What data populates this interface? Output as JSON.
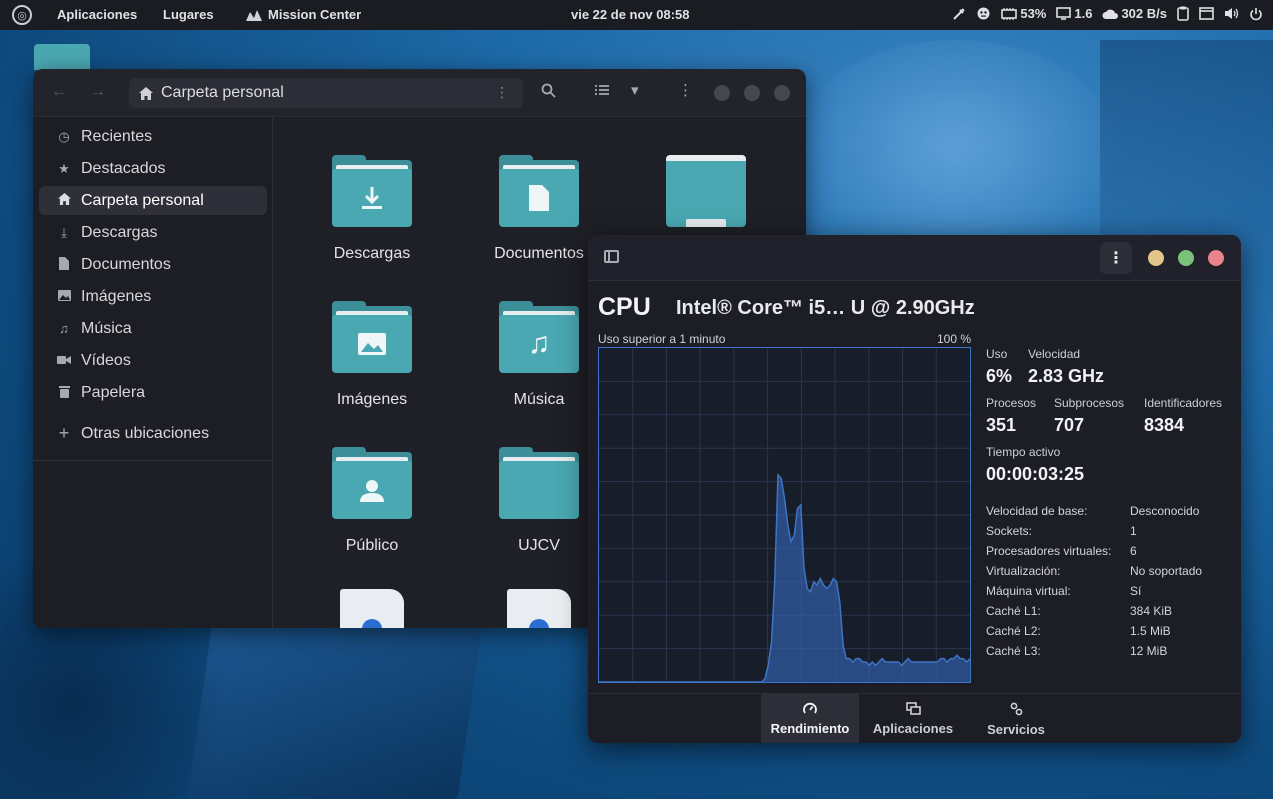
{
  "topbar": {
    "applications": "Aplicaciones",
    "places": "Lugares",
    "active_app": "Mission Center",
    "clock": "vie 22 de nov  08:58",
    "battery": "53%",
    "load": "1.6",
    "network": "302 B/s"
  },
  "file_manager": {
    "path": "Carpeta personal",
    "sidebar": [
      {
        "label": "Recientes",
        "icon": "clock-icon"
      },
      {
        "label": "Destacados",
        "icon": "star-icon"
      },
      {
        "label": "Carpeta personal",
        "icon": "home-icon",
        "active": true
      },
      {
        "label": "Descargas",
        "icon": "download-icon"
      },
      {
        "label": "Documentos",
        "icon": "document-icon"
      },
      {
        "label": "Imágenes",
        "icon": "image-icon"
      },
      {
        "label": "Música",
        "icon": "music-icon"
      },
      {
        "label": "Vídeos",
        "icon": "video-icon"
      },
      {
        "label": "Papelera",
        "icon": "trash-icon"
      }
    ],
    "other_locations": "Otras ubicaciones",
    "folders": [
      {
        "label": "Descargas",
        "icon": "download-icon"
      },
      {
        "label": "Documentos",
        "icon": "document-icon"
      },
      {
        "label": "",
        "icon": "folder-icon"
      },
      {
        "label": "Imágenes",
        "icon": "image-icon"
      },
      {
        "label": "Música",
        "icon": "music-icon"
      },
      {
        "label": "Público",
        "icon": "user-icon"
      },
      {
        "label": "UJCV",
        "icon": "folder-icon"
      }
    ]
  },
  "mission_center": {
    "title": "CPU",
    "model": "Intel® Core™ i5… U @ 2.90GHz",
    "graph_caption": "Uso superior a 1 minuto",
    "graph_max": "100 %",
    "usage_label": "Uso",
    "usage_value": "6%",
    "speed_label": "Velocidad",
    "speed_value": "2.83 GHz",
    "processes_label": "Procesos",
    "processes_value": "351",
    "threads_label": "Subprocesos",
    "threads_value": "707",
    "handles_label": "Identificadores",
    "handles_value": "8384",
    "uptime_label": "Tiempo activo",
    "uptime_value": "00:00:03:25",
    "details": [
      {
        "key": "Velocidad de base:",
        "value": "Desconocido"
      },
      {
        "key": "Sockets:",
        "value": "1"
      },
      {
        "key": "Procesadores virtuales:",
        "value": "6"
      },
      {
        "key": "Virtualización:",
        "value": "No soportado"
      },
      {
        "key": "Máquina virtual:",
        "value": "Sí"
      },
      {
        "key": "Caché L1:",
        "value": "384 KiB"
      },
      {
        "key": "Caché L2:",
        "value": "1.5 MiB"
      },
      {
        "key": "Caché L3:",
        "value": "12 MiB"
      }
    ],
    "tabs": [
      {
        "label": "Rendimiento",
        "icon": "gauge-icon",
        "active": true
      },
      {
        "label": "Aplicaciones",
        "icon": "windows-icon"
      },
      {
        "label": "Servicios",
        "icon": "gears-icon"
      }
    ],
    "cpu_history_percent": [
      0,
      0,
      0,
      0,
      0,
      0,
      0,
      0,
      0,
      0,
      0,
      0,
      0,
      0,
      0,
      0,
      0,
      0,
      0,
      0,
      0,
      0,
      0,
      0,
      0,
      0,
      0,
      0,
      0,
      0,
      0,
      0,
      0,
      0,
      0,
      0,
      0,
      0,
      0,
      0,
      0,
      0,
      0,
      0,
      0,
      0,
      0,
      0,
      0,
      0,
      0,
      1,
      5,
      12,
      30,
      62,
      61,
      55,
      47,
      42,
      44,
      52,
      53,
      34,
      28,
      27,
      30,
      29,
      31,
      29,
      28,
      29,
      31,
      30,
      24,
      11,
      7,
      7,
      6,
      7,
      7,
      6,
      6,
      5,
      6,
      5,
      6,
      7,
      6,
      6,
      6,
      6,
      6,
      5,
      6,
      7,
      6,
      6,
      6,
      6,
      6,
      6,
      6,
      6,
      6,
      7,
      7,
      6,
      7,
      7,
      8,
      7,
      7,
      6,
      7
    ]
  },
  "colors": {
    "folder": "#4aa8b2",
    "graph_line": "#3d74c4",
    "close": "#e9848d",
    "maximize": "#7cc27b",
    "minimize": "#e4c58c"
  }
}
